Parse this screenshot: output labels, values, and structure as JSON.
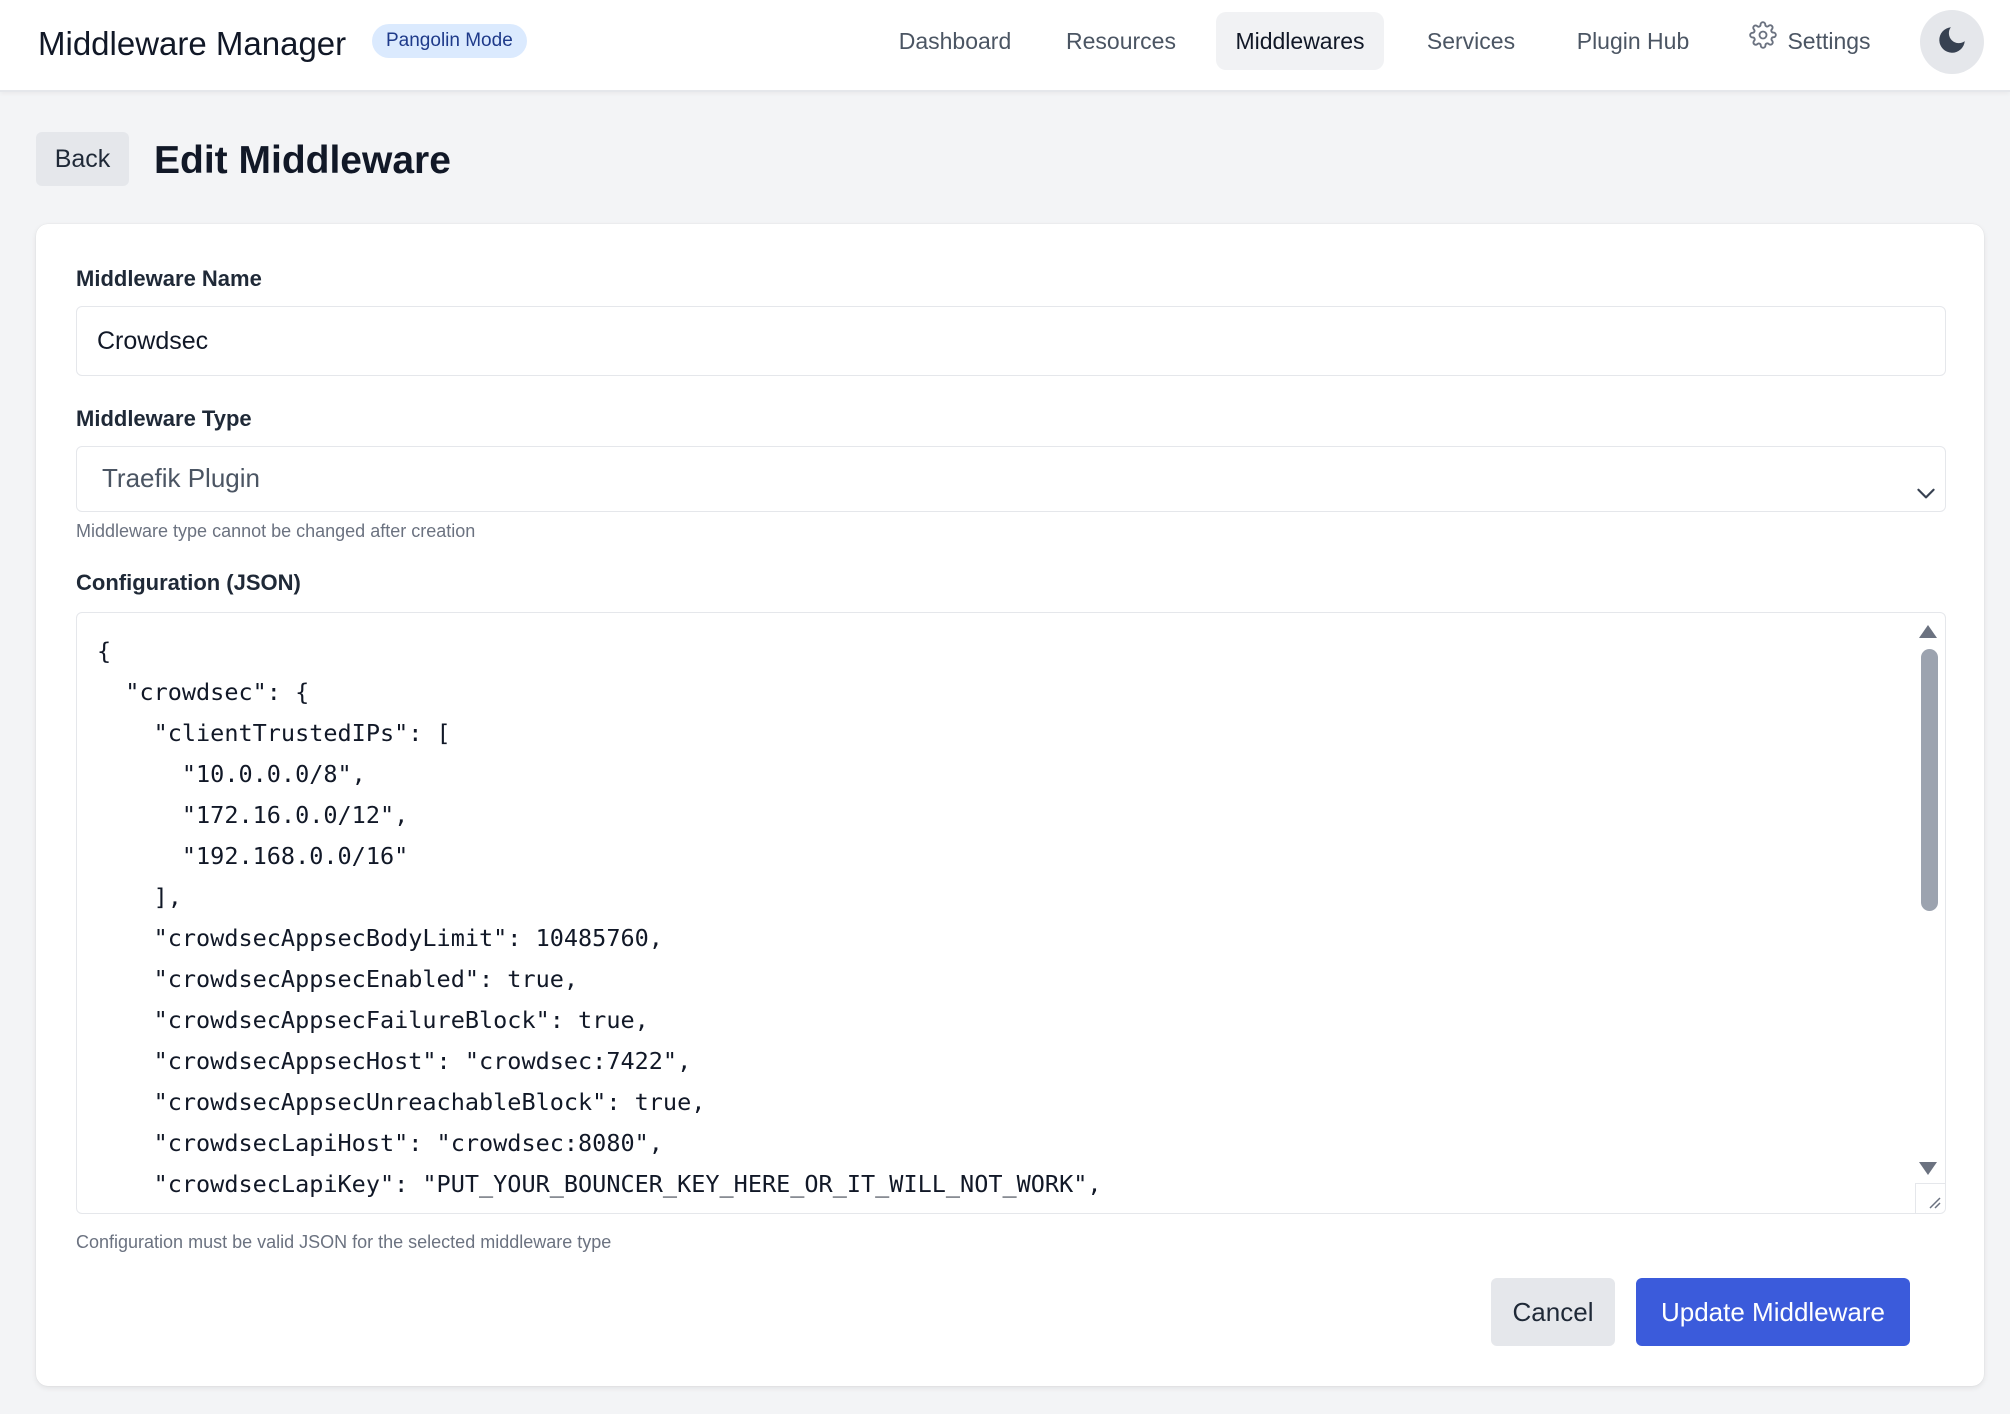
{
  "app": {
    "title": "Middleware Manager",
    "mode_badge": "Pangolin Mode"
  },
  "nav": {
    "items": [
      {
        "label": "Dashboard",
        "active": false
      },
      {
        "label": "Resources",
        "active": false
      },
      {
        "label": "Middlewares",
        "active": true
      },
      {
        "label": "Services",
        "active": false
      },
      {
        "label": "Plugin Hub",
        "active": false
      },
      {
        "label": "Settings",
        "active": false,
        "icon": "gear-icon"
      }
    ],
    "theme_toggle_icon": "moon-icon"
  },
  "page": {
    "back_label": "Back",
    "title": "Edit Middleware"
  },
  "form": {
    "name_label": "Middleware Name",
    "name_value": "Crowdsec",
    "type_label": "Middleware Type",
    "type_value": "Traefik Plugin",
    "type_helper": "Middleware type cannot be changed after creation",
    "config_label": "Configuration (JSON)",
    "config_lines": [
      "{",
      "  \"crowdsec\": {",
      "    \"clientTrustedIPs\": [",
      "      \"10.0.0.0/8\",",
      "      \"172.16.0.0/12\",",
      "      \"192.168.0.0/16\"",
      "    ],",
      "    \"crowdsecAppsecBodyLimit\": 10485760,",
      "    \"crowdsecAppsecEnabled\": true,",
      "    \"crowdsecAppsecFailureBlock\": true,",
      "    \"crowdsecAppsecHost\": \"crowdsec:7422\",",
      "    \"crowdsecAppsecUnreachableBlock\": true,",
      "    \"crowdsecLapiHost\": \"crowdsec:8080\",",
      "    \"crowdsecLapiKey\": \"PUT_YOUR_BOUNCER_KEY_HERE_OR_IT_WILL_NOT_WORK\","
    ],
    "config_helper": "Configuration must be valid JSON for the selected middleware type",
    "cancel_label": "Cancel",
    "submit_label": "Update Middleware"
  },
  "colors": {
    "primary": "#3b5bdb",
    "badge_bg": "#dbeafe",
    "badge_text": "#1e3a8a"
  }
}
